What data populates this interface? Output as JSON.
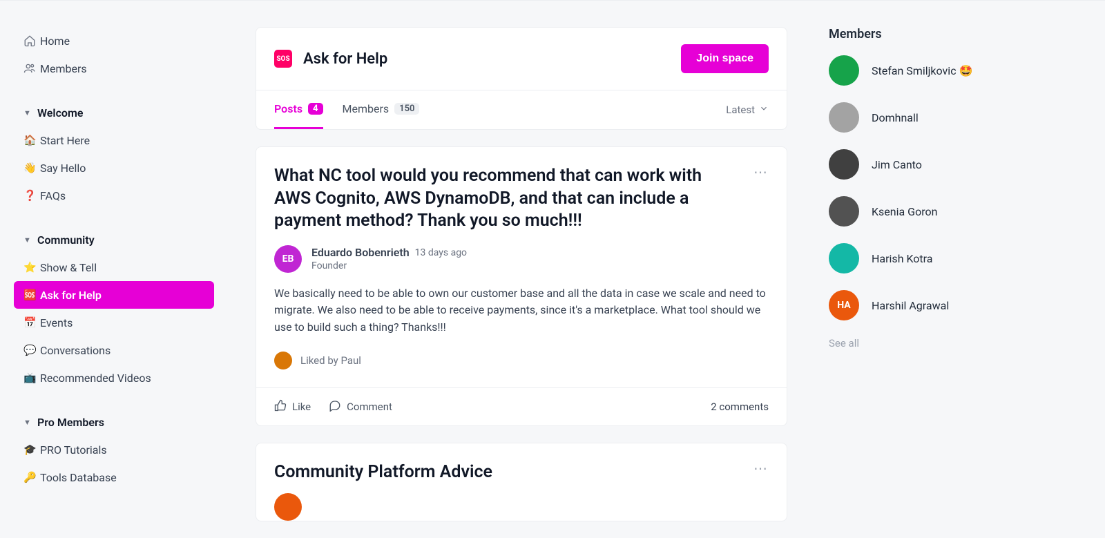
{
  "sidebar": {
    "home": "Home",
    "members": "Members",
    "sections": {
      "welcome": {
        "title": "Welcome",
        "items": [
          {
            "emoji": "🏠",
            "label": "Start Here"
          },
          {
            "emoji": "👋",
            "label": "Say Hello"
          },
          {
            "emoji": "❓",
            "label": "FAQs"
          }
        ]
      },
      "community": {
        "title": "Community",
        "items": [
          {
            "emoji": "⭐",
            "label": "Show & Tell"
          },
          {
            "emoji": "🆘",
            "label": "Ask for Help",
            "active": true
          },
          {
            "emoji": "📅",
            "label": "Events"
          },
          {
            "emoji": "💬",
            "label": "Conversations"
          },
          {
            "emoji": "📺",
            "label": "Recommended Videos"
          }
        ]
      },
      "pro": {
        "title": "Pro Members",
        "items": [
          {
            "emoji": "🎓",
            "label": "PRO Tutorials"
          },
          {
            "emoji": "🔑",
            "label": "Tools Database"
          }
        ]
      }
    }
  },
  "space": {
    "iconText": "SOS",
    "title": "Ask for Help",
    "joinButton": "Join space",
    "tabPostsLabel": "Posts",
    "tabPostsCount": "4",
    "tabMembersLabel": "Members",
    "tabMembersCount": "150",
    "sortLabel": "Latest"
  },
  "post": {
    "title": "What NC tool would you recommend that can work with AWS Cognito, AWS DynamoDB, and that can include a payment method? Thank you so much!!!",
    "author": {
      "initials": "EB",
      "initialsColor": "#c026d3",
      "name": "Eduardo Bobenrieth",
      "role": "Founder"
    },
    "timeAgo": "13 days ago",
    "body": "We basically need to be able to own our customer base and all the data in case we scale and need to migrate. We also need to be able to receive payments, since it's a marketplace. What tool should we use to build such a thing? Thanks!!!",
    "likedBy": "Liked by Paul",
    "likedByAvatarColor": "#d97706",
    "likeAction": "Like",
    "commentAction": "Comment",
    "commentCount": "2 comments"
  },
  "post2": {
    "title": "Community Platform Advice"
  },
  "membersPanel": {
    "title": "Members",
    "list": [
      {
        "name": "Stefan Smiljkovic 🤩",
        "color": "#16a34a"
      },
      {
        "name": "Domhnall",
        "color": "#a3a3a3"
      },
      {
        "name": "Jim Canto",
        "color": "#404040"
      },
      {
        "name": "Ksenia Goron",
        "color": "#525252"
      },
      {
        "name": "Harish Kotra",
        "color": "#14b8a6"
      },
      {
        "name": "Harshil Agrawal",
        "color": "#ea580c",
        "initials": "HA"
      }
    ],
    "seeAll": "See all"
  }
}
